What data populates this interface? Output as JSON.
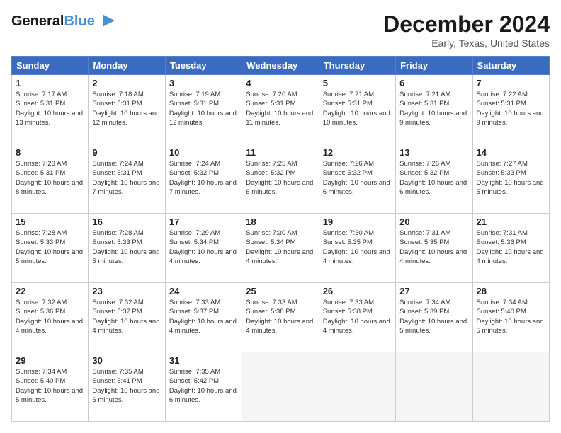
{
  "header": {
    "logo_line1": "General",
    "logo_line2": "Blue",
    "month_title": "December 2024",
    "subtitle": "Early, Texas, United States"
  },
  "days_of_week": [
    "Sunday",
    "Monday",
    "Tuesday",
    "Wednesday",
    "Thursday",
    "Friday",
    "Saturday"
  ],
  "weeks": [
    [
      {
        "day": "1",
        "sunrise": "7:17 AM",
        "sunset": "5:31 PM",
        "daylight": "10 hours and 13 minutes."
      },
      {
        "day": "2",
        "sunrise": "7:18 AM",
        "sunset": "5:31 PM",
        "daylight": "10 hours and 12 minutes."
      },
      {
        "day": "3",
        "sunrise": "7:19 AM",
        "sunset": "5:31 PM",
        "daylight": "10 hours and 12 minutes."
      },
      {
        "day": "4",
        "sunrise": "7:20 AM",
        "sunset": "5:31 PM",
        "daylight": "10 hours and 11 minutes."
      },
      {
        "day": "5",
        "sunrise": "7:21 AM",
        "sunset": "5:31 PM",
        "daylight": "10 hours and 10 minutes."
      },
      {
        "day": "6",
        "sunrise": "7:21 AM",
        "sunset": "5:31 PM",
        "daylight": "10 hours and 9 minutes."
      },
      {
        "day": "7",
        "sunrise": "7:22 AM",
        "sunset": "5:31 PM",
        "daylight": "10 hours and 9 minutes."
      }
    ],
    [
      {
        "day": "8",
        "sunrise": "7:23 AM",
        "sunset": "5:31 PM",
        "daylight": "10 hours and 8 minutes."
      },
      {
        "day": "9",
        "sunrise": "7:24 AM",
        "sunset": "5:31 PM",
        "daylight": "10 hours and 7 minutes."
      },
      {
        "day": "10",
        "sunrise": "7:24 AM",
        "sunset": "5:32 PM",
        "daylight": "10 hours and 7 minutes."
      },
      {
        "day": "11",
        "sunrise": "7:25 AM",
        "sunset": "5:32 PM",
        "daylight": "10 hours and 6 minutes."
      },
      {
        "day": "12",
        "sunrise": "7:26 AM",
        "sunset": "5:32 PM",
        "daylight": "10 hours and 6 minutes."
      },
      {
        "day": "13",
        "sunrise": "7:26 AM",
        "sunset": "5:32 PM",
        "daylight": "10 hours and 6 minutes."
      },
      {
        "day": "14",
        "sunrise": "7:27 AM",
        "sunset": "5:33 PM",
        "daylight": "10 hours and 5 minutes."
      }
    ],
    [
      {
        "day": "15",
        "sunrise": "7:28 AM",
        "sunset": "5:33 PM",
        "daylight": "10 hours and 5 minutes."
      },
      {
        "day": "16",
        "sunrise": "7:28 AM",
        "sunset": "5:33 PM",
        "daylight": "10 hours and 5 minutes."
      },
      {
        "day": "17",
        "sunrise": "7:29 AM",
        "sunset": "5:34 PM",
        "daylight": "10 hours and 4 minutes."
      },
      {
        "day": "18",
        "sunrise": "7:30 AM",
        "sunset": "5:34 PM",
        "daylight": "10 hours and 4 minutes."
      },
      {
        "day": "19",
        "sunrise": "7:30 AM",
        "sunset": "5:35 PM",
        "daylight": "10 hours and 4 minutes."
      },
      {
        "day": "20",
        "sunrise": "7:31 AM",
        "sunset": "5:35 PM",
        "daylight": "10 hours and 4 minutes."
      },
      {
        "day": "21",
        "sunrise": "7:31 AM",
        "sunset": "5:36 PM",
        "daylight": "10 hours and 4 minutes."
      }
    ],
    [
      {
        "day": "22",
        "sunrise": "7:32 AM",
        "sunset": "5:36 PM",
        "daylight": "10 hours and 4 minutes."
      },
      {
        "day": "23",
        "sunrise": "7:32 AM",
        "sunset": "5:37 PM",
        "daylight": "10 hours and 4 minutes."
      },
      {
        "day": "24",
        "sunrise": "7:33 AM",
        "sunset": "5:37 PM",
        "daylight": "10 hours and 4 minutes."
      },
      {
        "day": "25",
        "sunrise": "7:33 AM",
        "sunset": "5:38 PM",
        "daylight": "10 hours and 4 minutes."
      },
      {
        "day": "26",
        "sunrise": "7:33 AM",
        "sunset": "5:38 PM",
        "daylight": "10 hours and 4 minutes."
      },
      {
        "day": "27",
        "sunrise": "7:34 AM",
        "sunset": "5:39 PM",
        "daylight": "10 hours and 5 minutes."
      },
      {
        "day": "28",
        "sunrise": "7:34 AM",
        "sunset": "5:40 PM",
        "daylight": "10 hours and 5 minutes."
      }
    ],
    [
      {
        "day": "29",
        "sunrise": "7:34 AM",
        "sunset": "5:40 PM",
        "daylight": "10 hours and 5 minutes."
      },
      {
        "day": "30",
        "sunrise": "7:35 AM",
        "sunset": "5:41 PM",
        "daylight": "10 hours and 6 minutes."
      },
      {
        "day": "31",
        "sunrise": "7:35 AM",
        "sunset": "5:42 PM",
        "daylight": "10 hours and 6 minutes."
      },
      null,
      null,
      null,
      null
    ]
  ]
}
